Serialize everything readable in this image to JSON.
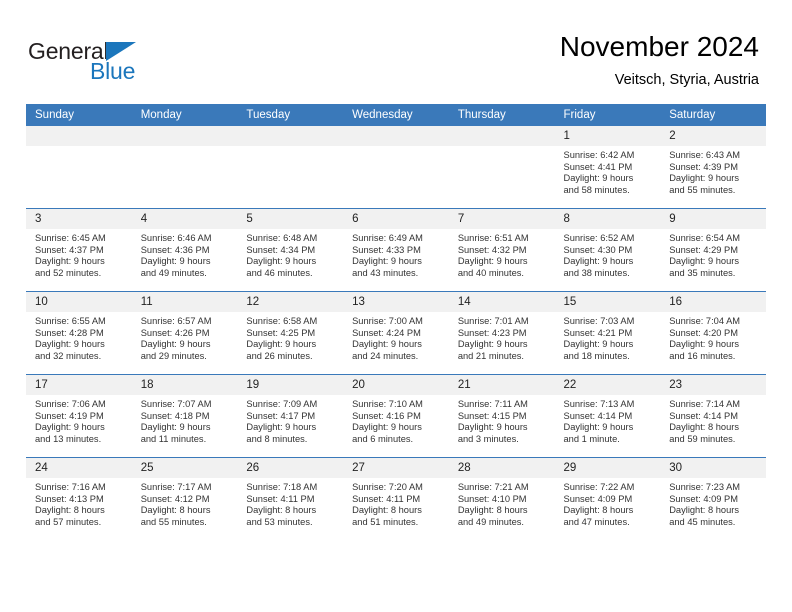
{
  "brand": {
    "name_part1": "General",
    "name_part2": "Blue",
    "accent_color": "#1b76bc"
  },
  "header": {
    "title": "November 2024",
    "subtitle": "Veitsch, Styria, Austria"
  },
  "theme": {
    "header_row_bg": "#3a79ba",
    "daynum_bg": "#f1f1f1",
    "text_color": "#333333"
  },
  "weekdays": [
    "Sunday",
    "Monday",
    "Tuesday",
    "Wednesday",
    "Thursday",
    "Friday",
    "Saturday"
  ],
  "weeks": [
    [
      {
        "day": "",
        "empty": true
      },
      {
        "day": "",
        "empty": true
      },
      {
        "day": "",
        "empty": true
      },
      {
        "day": "",
        "empty": true
      },
      {
        "day": "",
        "empty": true
      },
      {
        "day": "1",
        "sunrise": "Sunrise: 6:42 AM",
        "sunset": "Sunset: 4:41 PM",
        "daylight1": "Daylight: 9 hours",
        "daylight2": "and 58 minutes."
      },
      {
        "day": "2",
        "sunrise": "Sunrise: 6:43 AM",
        "sunset": "Sunset: 4:39 PM",
        "daylight1": "Daylight: 9 hours",
        "daylight2": "and 55 minutes."
      }
    ],
    [
      {
        "day": "3",
        "sunrise": "Sunrise: 6:45 AM",
        "sunset": "Sunset: 4:37 PM",
        "daylight1": "Daylight: 9 hours",
        "daylight2": "and 52 minutes."
      },
      {
        "day": "4",
        "sunrise": "Sunrise: 6:46 AM",
        "sunset": "Sunset: 4:36 PM",
        "daylight1": "Daylight: 9 hours",
        "daylight2": "and 49 minutes."
      },
      {
        "day": "5",
        "sunrise": "Sunrise: 6:48 AM",
        "sunset": "Sunset: 4:34 PM",
        "daylight1": "Daylight: 9 hours",
        "daylight2": "and 46 minutes."
      },
      {
        "day": "6",
        "sunrise": "Sunrise: 6:49 AM",
        "sunset": "Sunset: 4:33 PM",
        "daylight1": "Daylight: 9 hours",
        "daylight2": "and 43 minutes."
      },
      {
        "day": "7",
        "sunrise": "Sunrise: 6:51 AM",
        "sunset": "Sunset: 4:32 PM",
        "daylight1": "Daylight: 9 hours",
        "daylight2": "and 40 minutes."
      },
      {
        "day": "8",
        "sunrise": "Sunrise: 6:52 AM",
        "sunset": "Sunset: 4:30 PM",
        "daylight1": "Daylight: 9 hours",
        "daylight2": "and 38 minutes."
      },
      {
        "day": "9",
        "sunrise": "Sunrise: 6:54 AM",
        "sunset": "Sunset: 4:29 PM",
        "daylight1": "Daylight: 9 hours",
        "daylight2": "and 35 minutes."
      }
    ],
    [
      {
        "day": "10",
        "sunrise": "Sunrise: 6:55 AM",
        "sunset": "Sunset: 4:28 PM",
        "daylight1": "Daylight: 9 hours",
        "daylight2": "and 32 minutes."
      },
      {
        "day": "11",
        "sunrise": "Sunrise: 6:57 AM",
        "sunset": "Sunset: 4:26 PM",
        "daylight1": "Daylight: 9 hours",
        "daylight2": "and 29 minutes."
      },
      {
        "day": "12",
        "sunrise": "Sunrise: 6:58 AM",
        "sunset": "Sunset: 4:25 PM",
        "daylight1": "Daylight: 9 hours",
        "daylight2": "and 26 minutes."
      },
      {
        "day": "13",
        "sunrise": "Sunrise: 7:00 AM",
        "sunset": "Sunset: 4:24 PM",
        "daylight1": "Daylight: 9 hours",
        "daylight2": "and 24 minutes."
      },
      {
        "day": "14",
        "sunrise": "Sunrise: 7:01 AM",
        "sunset": "Sunset: 4:23 PM",
        "daylight1": "Daylight: 9 hours",
        "daylight2": "and 21 minutes."
      },
      {
        "day": "15",
        "sunrise": "Sunrise: 7:03 AM",
        "sunset": "Sunset: 4:21 PM",
        "daylight1": "Daylight: 9 hours",
        "daylight2": "and 18 minutes."
      },
      {
        "day": "16",
        "sunrise": "Sunrise: 7:04 AM",
        "sunset": "Sunset: 4:20 PM",
        "daylight1": "Daylight: 9 hours",
        "daylight2": "and 16 minutes."
      }
    ],
    [
      {
        "day": "17",
        "sunrise": "Sunrise: 7:06 AM",
        "sunset": "Sunset: 4:19 PM",
        "daylight1": "Daylight: 9 hours",
        "daylight2": "and 13 minutes."
      },
      {
        "day": "18",
        "sunrise": "Sunrise: 7:07 AM",
        "sunset": "Sunset: 4:18 PM",
        "daylight1": "Daylight: 9 hours",
        "daylight2": "and 11 minutes."
      },
      {
        "day": "19",
        "sunrise": "Sunrise: 7:09 AM",
        "sunset": "Sunset: 4:17 PM",
        "daylight1": "Daylight: 9 hours",
        "daylight2": "and 8 minutes."
      },
      {
        "day": "20",
        "sunrise": "Sunrise: 7:10 AM",
        "sunset": "Sunset: 4:16 PM",
        "daylight1": "Daylight: 9 hours",
        "daylight2": "and 6 minutes."
      },
      {
        "day": "21",
        "sunrise": "Sunrise: 7:11 AM",
        "sunset": "Sunset: 4:15 PM",
        "daylight1": "Daylight: 9 hours",
        "daylight2": "and 3 minutes."
      },
      {
        "day": "22",
        "sunrise": "Sunrise: 7:13 AM",
        "sunset": "Sunset: 4:14 PM",
        "daylight1": "Daylight: 9 hours",
        "daylight2": "and 1 minute."
      },
      {
        "day": "23",
        "sunrise": "Sunrise: 7:14 AM",
        "sunset": "Sunset: 4:14 PM",
        "daylight1": "Daylight: 8 hours",
        "daylight2": "and 59 minutes."
      }
    ],
    [
      {
        "day": "24",
        "sunrise": "Sunrise: 7:16 AM",
        "sunset": "Sunset: 4:13 PM",
        "daylight1": "Daylight: 8 hours",
        "daylight2": "and 57 minutes."
      },
      {
        "day": "25",
        "sunrise": "Sunrise: 7:17 AM",
        "sunset": "Sunset: 4:12 PM",
        "daylight1": "Daylight: 8 hours",
        "daylight2": "and 55 minutes."
      },
      {
        "day": "26",
        "sunrise": "Sunrise: 7:18 AM",
        "sunset": "Sunset: 4:11 PM",
        "daylight1": "Daylight: 8 hours",
        "daylight2": "and 53 minutes."
      },
      {
        "day": "27",
        "sunrise": "Sunrise: 7:20 AM",
        "sunset": "Sunset: 4:11 PM",
        "daylight1": "Daylight: 8 hours",
        "daylight2": "and 51 minutes."
      },
      {
        "day": "28",
        "sunrise": "Sunrise: 7:21 AM",
        "sunset": "Sunset: 4:10 PM",
        "daylight1": "Daylight: 8 hours",
        "daylight2": "and 49 minutes."
      },
      {
        "day": "29",
        "sunrise": "Sunrise: 7:22 AM",
        "sunset": "Sunset: 4:09 PM",
        "daylight1": "Daylight: 8 hours",
        "daylight2": "and 47 minutes."
      },
      {
        "day": "30",
        "sunrise": "Sunrise: 7:23 AM",
        "sunset": "Sunset: 4:09 PM",
        "daylight1": "Daylight: 8 hours",
        "daylight2": "and 45 minutes."
      }
    ]
  ]
}
